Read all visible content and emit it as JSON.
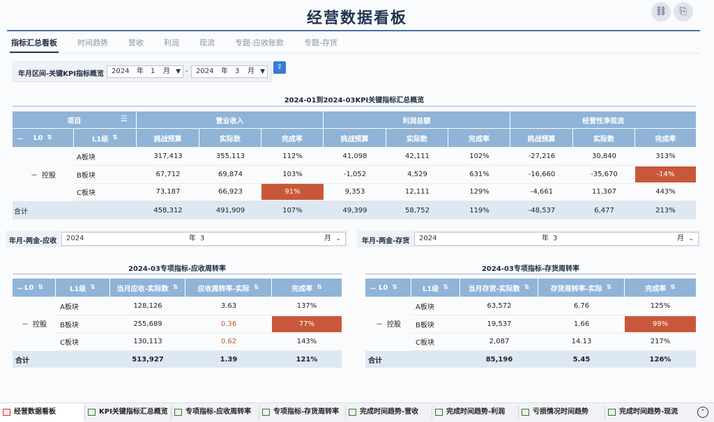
{
  "title": "经营数据看板",
  "top_icons": [
    "link-icon",
    "exit-icon"
  ],
  "tabs": [
    "指标汇总看板",
    "时间趋势",
    "营收",
    "利润",
    "现流",
    "专题-应收账款",
    "专题-存货"
  ],
  "filter1": {
    "label": "年月区间-关键KPI指标概览",
    "from_year": "2024",
    "year_unit": "年",
    "from_month": "1",
    "month_unit": "月",
    "dash": "-",
    "to_year": "2024",
    "to_month": "3"
  },
  "main_table": {
    "title": "2024-01到2024-03KPI关键指标汇总概览",
    "header_item": "项目",
    "groups": [
      "营业收入",
      "利润总额",
      "经营性净现流"
    ],
    "sub_l0": "L0",
    "sub_l1": "L1级",
    "metrics": [
      "挑战预算",
      "实际数",
      "完成率"
    ],
    "collapse": "－",
    "l0_name": "控股",
    "rows": [
      {
        "l1": "A板块",
        "v": [
          "317,413",
          "355,113",
          "112%",
          "41,098",
          "42,111",
          "102%",
          "-27,216",
          "30,840",
          "313%"
        ]
      },
      {
        "l1": "B板块",
        "v": [
          "67,712",
          "69,874",
          "103%",
          "-1,052",
          "4,529",
          "631%",
          "-16,660",
          "-35,670",
          "-14%"
        ]
      },
      {
        "l1": "C板块",
        "v": [
          "73,187",
          "66,923",
          "91%",
          "9,353",
          "12,111",
          "129%",
          "-4,661",
          "11,307",
          "443%"
        ]
      }
    ],
    "total": {
      "label": "合计",
      "v": [
        "458,312",
        "491,909",
        "107%",
        "49,399",
        "58,752",
        "119%",
        "-48,537",
        "6,477",
        "213%"
      ]
    }
  },
  "filter_ar": {
    "label": "年月-两金-应收",
    "year": "2024",
    "year_unit": "年",
    "month": "3",
    "month_unit": "月"
  },
  "filter_inv": {
    "label": "年月-两金-存货",
    "year": "2024",
    "year_unit": "年",
    "month": "3",
    "month_unit": "月"
  },
  "ar_table": {
    "title": "2024-03专项指标-应收周转率",
    "headers": [
      "L0",
      "L1级",
      "当月应收-实际数",
      "应收周转率-实际",
      "完成率"
    ],
    "l0_name": "控股",
    "rows": [
      {
        "l1": "A板块",
        "v": [
          "128,126",
          "3.63",
          "137%"
        ]
      },
      {
        "l1": "B板块",
        "v": [
          "255,689",
          "0.36",
          "77%"
        ]
      },
      {
        "l1": "C板块",
        "v": [
          "130,113",
          "0.62",
          "143%"
        ]
      }
    ],
    "total": {
      "label": "合计",
      "v": [
        "513,927",
        "1.39",
        "121%"
      ]
    }
  },
  "inv_table": {
    "title": "2024-03专项指标-存货周转率",
    "headers": [
      "L0",
      "L1级",
      "当月存货-实际数",
      "存货周转率-实际",
      "完成率"
    ],
    "l0_name": "控股",
    "rows": [
      {
        "l1": "A板块",
        "v": [
          "63,572",
          "6.76",
          "125%"
        ]
      },
      {
        "l1": "B板块",
        "v": [
          "19,537",
          "1.66",
          "99%"
        ]
      },
      {
        "l1": "C板块",
        "v": [
          "2,087",
          "14.13",
          "217%"
        ]
      }
    ],
    "total": {
      "label": "合计",
      "v": [
        "85,196",
        "5.45",
        "126%"
      ]
    }
  },
  "sheets": [
    "经营数据看板",
    "KPI关键指标汇总概览",
    "专项指标-应收周转率",
    "专项指标-存货周转率",
    "完成时间趋势-营收",
    "完成时间趋势-利润",
    "亏损情况时间趋势",
    "完成时间趋势-现流"
  ],
  "colors": {
    "header": "#8fb4d8",
    "alert": "#c9583a",
    "total_row": "#dde8f3",
    "title": "#1f3552"
  }
}
